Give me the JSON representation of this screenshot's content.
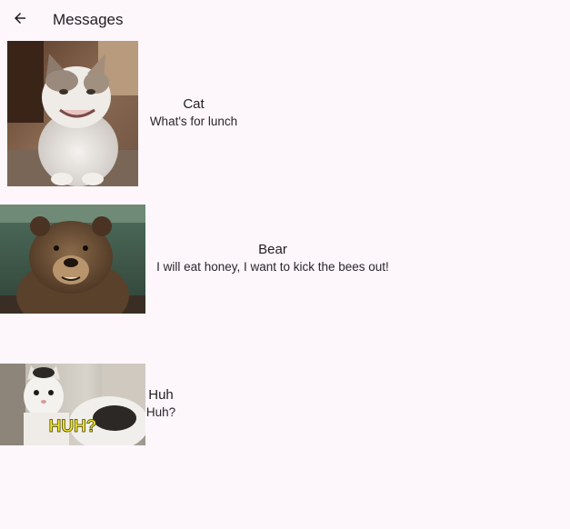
{
  "app_bar": {
    "title": "Messages",
    "back_icon": "arrow-back-icon"
  },
  "messages": [
    {
      "sender": "Cat",
      "preview": "What's for lunch",
      "image": "smiling-cat-photo"
    },
    {
      "sender": "Bear",
      "preview": "I will eat honey, I want to kick the bees out!",
      "image": "brown-bear-photo"
    },
    {
      "sender": "Huh",
      "preview": "Huh?",
      "image": "huh-cat-photo",
      "image_caption": "HUH?"
    }
  ]
}
